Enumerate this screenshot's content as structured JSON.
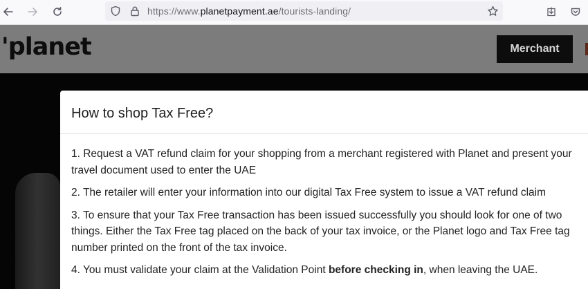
{
  "browser": {
    "url_prefix": "https://www.",
    "url_domain": "planetpayment.ae",
    "url_path": "/tourists-landing/"
  },
  "header": {
    "logo_text": "'planet",
    "merchant_button": "Merchant"
  },
  "modal": {
    "title": "How to shop Tax Free?",
    "steps": [
      "1. Request a VAT refund claim for your shopping from a merchant registered with Planet and present your travel document used to enter the UAE",
      "2. The retailer will enter your information into our digital Tax Free system to issue a VAT refund claim",
      "3. To ensure that your Tax Free transaction has been issued successfully you should look for one of two things. Either the Tax Free tag placed on the back of your tax invoice, or the Planet logo and Tax Free tag number printed on the front of the tax invoice."
    ],
    "step4": {
      "before": "4. You must validate your claim at the Validation Point ",
      "bold": "before checking in",
      "after": ", when leaving the UAE."
    }
  }
}
